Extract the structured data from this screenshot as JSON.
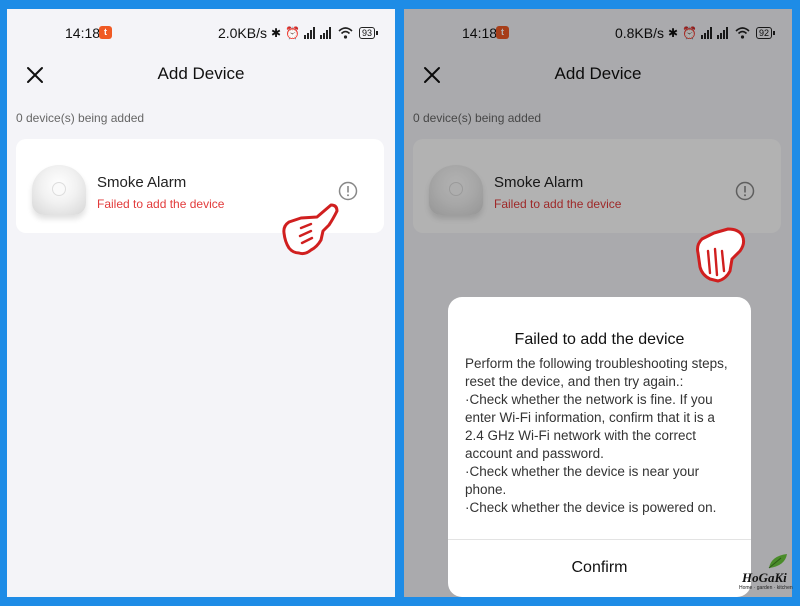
{
  "left_screen": {
    "status_bar": {
      "time": "14:18",
      "app_badge": "t",
      "speed": "2.0KB/s",
      "battery": "93"
    },
    "header": {
      "title": "Add Device"
    },
    "devices_count": "0 device(s) being added",
    "device": {
      "name": "Smoke Alarm",
      "status": "Failed to add the device"
    }
  },
  "right_screen": {
    "status_bar": {
      "time": "14:18",
      "app_badge": "t",
      "speed": "0.8KB/s",
      "battery": "92"
    },
    "header": {
      "title": "Add Device"
    },
    "devices_count": "0 device(s) being added",
    "device": {
      "name": "Smoke Alarm",
      "status": "Failed to add the device"
    },
    "dialog": {
      "title": "Failed to add the device",
      "intro": "Perform the following troubleshooting steps, reset the device, and then try again.:",
      "steps": [
        "·Check whether the network is fine. If you enter Wi-Fi information, confirm that it is a 2.4 GHz Wi-Fi network with the correct account and password.",
        "·Check whether the device is near your phone.",
        "·Check whether the device is powered on."
      ],
      "confirm_label": "Confirm"
    }
  },
  "status_icons": [
    "bluetooth-icon",
    "alarm-icon",
    "signal-icon",
    "wifi-icon",
    "battery-icon"
  ],
  "logo": {
    "text": "HoGaKi",
    "tagline": "Home · garden · kitchen"
  },
  "colors": {
    "frame": "#1e8ce6",
    "error_text": "#e23b3b",
    "hand_outline": "#d01f1f",
    "app_badge": "#f05a24"
  }
}
